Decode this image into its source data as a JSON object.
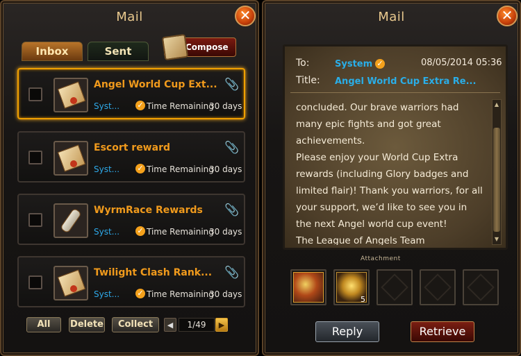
{
  "left": {
    "title": "Mail",
    "close_label": "✕",
    "tabs": [
      "Inbox",
      "Sent"
    ],
    "compose_label": "Compose",
    "mails": [
      {
        "subject": "Angel World Cup Ext...",
        "sender": "Syst...",
        "time_label": "Time Remaining",
        "time_value": "30 days",
        "icon": "letter-scroll-icon"
      },
      {
        "subject": "Escort reward",
        "sender": "Syst...",
        "time_label": "Time Remaining",
        "time_value": "30 days",
        "icon": "letter-scroll-icon"
      },
      {
        "subject": "WyrmRace Rewards",
        "sender": "Syst...",
        "time_label": "Time Remaining",
        "time_value": "30 days",
        "icon": "rolled-scroll-icon"
      },
      {
        "subject": "Twilight Clash Rank...",
        "sender": "Syst...",
        "time_label": "Time Remaining",
        "time_value": "30 days",
        "icon": "letter-scroll-icon"
      }
    ],
    "buttons": {
      "all": "All",
      "delete": "Delete",
      "collect": "Collect"
    },
    "pager": {
      "prev": "◀",
      "page": "1/49",
      "next": "▶"
    }
  },
  "right": {
    "title": "Mail",
    "close_label": "✕",
    "to_label": "To:",
    "to_value": "System",
    "date": "08/05/2014 05:36",
    "title_label": "Title:",
    "title_value": "Angel World Cup Extra Re...",
    "body_lines": [
      "concluded. Our brave warriors had",
      "many epic fights and got great",
      "achievements.",
      "Please enjoy your World Cup Extra",
      "rewards (including Glory badges and",
      "limited flair)! Thank you warriors, for all",
      "your support, we’d like to see you in",
      "the next Angel world cup event!",
      "The League of Angels Team"
    ],
    "attachment_label": "Attachment",
    "attachments": [
      {
        "icon": "crossed-weapons-emblem-icon",
        "count": ""
      },
      {
        "icon": "golden-armor-icon",
        "count": "5"
      }
    ],
    "reply_label": "Reply",
    "retrieve_label": "Retrieve"
  },
  "colors": {
    "accent_orange": "#f09a1c",
    "sender_blue": "#2ea8e8",
    "selected_border": "#f0a000"
  }
}
